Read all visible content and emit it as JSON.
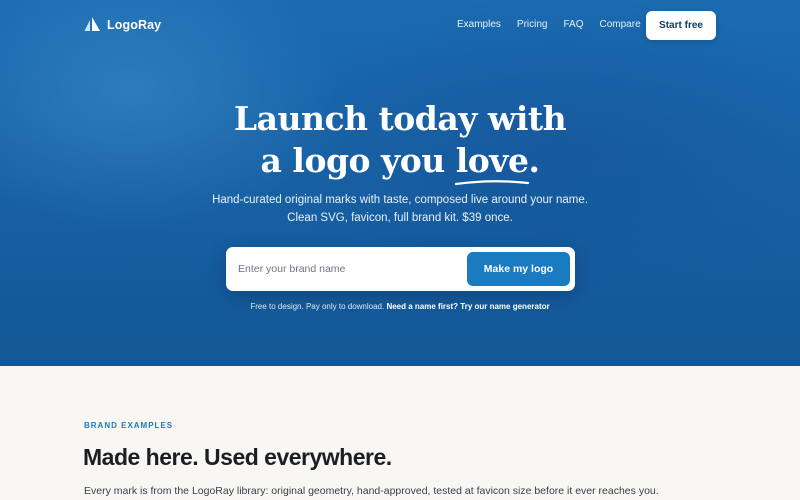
{
  "brand": {
    "name": "LogoRay"
  },
  "nav": {
    "links": [
      "Examples",
      "Pricing",
      "FAQ",
      "Compare"
    ],
    "cta": "Start free"
  },
  "hero": {
    "headline_line1": "Launch today with",
    "headline_line2_prefix": "a logo you ",
    "headline_line2_emph": "love",
    "headline_line2_suffix": ".",
    "subtext_line1": "Hand-curated original marks with taste, composed live around your name.",
    "subtext_line2": "Clean SVG, favicon, full brand kit. $39 once.",
    "input_placeholder": "Enter your brand name",
    "input_value": "",
    "submit_label": "Make my logo",
    "note_plain": "Free to design. Pay only to download.",
    "note_bold": "Need a name first? Try our name generator"
  },
  "examples": {
    "eyebrow": "BRAND EXAMPLES",
    "title": "Made here. Used everywhere.",
    "description": "Every mark is from the LogoRay library: original geometry, hand-approved, tested at favicon size before it ever reaches you."
  },
  "colors": {
    "hero_blue": "#1862a6",
    "accent": "#1a7bc0",
    "page_bg": "#f8f7f3",
    "text_dark": "#1b1f24"
  }
}
